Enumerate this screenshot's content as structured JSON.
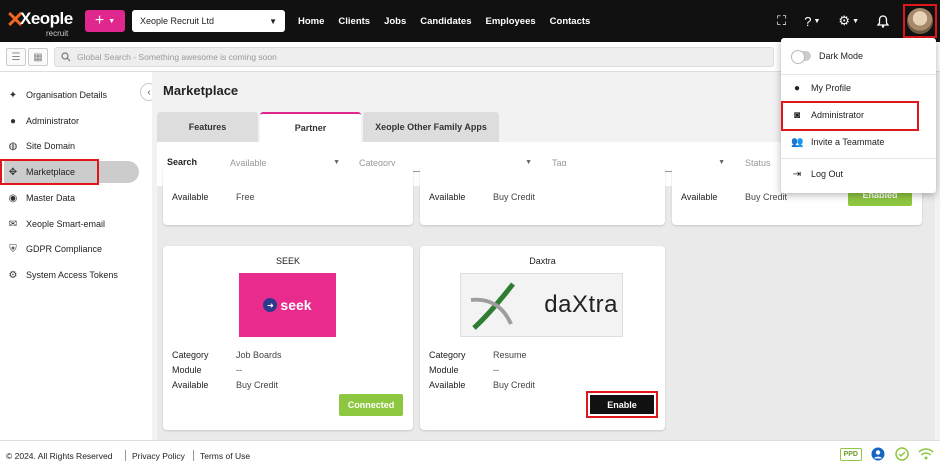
{
  "brand": {
    "logo_text": "Xeople",
    "logo_sub": "recruit",
    "accent": "#e0278d",
    "logo_color": "#f26522",
    "highlight": "#e0161d"
  },
  "topbar": {
    "plus_label": "+",
    "company": "Xeople Recruit Ltd",
    "nav": [
      "Home",
      "Clients",
      "Jobs",
      "Candidates",
      "Employees",
      "Contacts"
    ],
    "icons": [
      "fullscreen-icon",
      "help-icon",
      "settings-icon",
      "bell-icon"
    ]
  },
  "search": {
    "placeholder": "Global Search - Something awesome is coming soon"
  },
  "sidebar": {
    "items": [
      {
        "label": "Organisation Details",
        "icon": "person-star-icon"
      },
      {
        "label": "Administrator",
        "icon": "person-icon"
      },
      {
        "label": "Site Domain",
        "icon": "globe-icon"
      },
      {
        "label": "Marketplace",
        "icon": "marketplace-icon",
        "active": true
      },
      {
        "label": "Master Data",
        "icon": "database-icon"
      },
      {
        "label": "Xeople Smart-email",
        "icon": "mail-icon"
      },
      {
        "label": "GDPR Compliance",
        "icon": "shield-icon"
      },
      {
        "label": "System Access Tokens",
        "icon": "gear-icon"
      }
    ]
  },
  "main": {
    "title": "Marketplace",
    "tabs": [
      {
        "label": "Features"
      },
      {
        "label": "Partner",
        "active": true
      },
      {
        "label": "Xeople Other Family Apps"
      }
    ],
    "filters": {
      "label": "Search",
      "available": "Available",
      "category": "Category",
      "tag": "Tag",
      "status": "Status"
    },
    "top_cards": [
      {
        "available_label": "Available",
        "available": "Free"
      },
      {
        "available_label": "Available",
        "available": "Buy Credit"
      },
      {
        "available_label": "Available",
        "available": "Buy Credit",
        "button": "Enabled"
      }
    ],
    "cards": [
      {
        "name": "SEEK",
        "logo": "seek",
        "category_label": "Category",
        "category": "Job Boards",
        "module_label": "Module",
        "module": "--",
        "available_label": "Available",
        "available": "Buy Credit",
        "button": "Connected"
      },
      {
        "name": "Daxtra",
        "logo": "daXtra",
        "category_label": "Category",
        "category": "Resume",
        "module_label": "Module",
        "module": "--",
        "available_label": "Available",
        "available": "Buy Credit",
        "button": "Enable"
      }
    ]
  },
  "user_menu": {
    "dark_mode": "Dark Mode",
    "profile": "My Profile",
    "administrator": "Administrator",
    "invite": "Invite a Teammate",
    "logout": "Log Out"
  },
  "footer": {
    "copyright": "© 2024. All Rights Reserved",
    "privacy": "Privacy Policy",
    "terms": "Terms of Use",
    "badge": "PPD"
  }
}
